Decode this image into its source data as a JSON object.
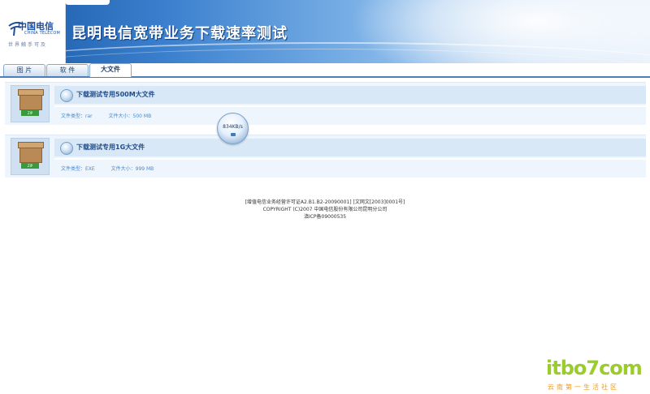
{
  "header": {
    "logo_cn": "中国电信",
    "logo_en": "CHINA TELECOM",
    "logo_slogan": "世界触手可及",
    "title": "昆明电信宽带业务下载速率测试"
  },
  "tabs": [
    {
      "label": "图 片",
      "active": false
    },
    {
      "label": "软 件",
      "active": false
    },
    {
      "label": "大文件",
      "active": true
    }
  ],
  "files": [
    {
      "name": "下载测试专用500M大文件",
      "type_label": "文件类型：rar",
      "size_label": "文件大小：500 MB",
      "icon": "zip-box-icon",
      "icon_tag": "ZIP"
    },
    {
      "name": "下载测试专用1G大文件",
      "type_label": "文件类型：EXE",
      "size_label": "文件大小：999 MB",
      "icon": "zip-box-icon",
      "icon_tag": "ZIP"
    }
  ],
  "speed_indicator": "834KB/s",
  "footer": {
    "line1": "[增值电信业务经营许可证A2.B1.B2-20090001] [文网文[2003]0001号]",
    "line2": "COPYRIGHT (C)2007 中国电信股份有限公司昆明分公司",
    "line3": "滇ICP备09000535"
  },
  "watermark": {
    "main": "itbo7com",
    "sub": "云南第一生活社区"
  },
  "colors": {
    "header_start": "#1a5aa8",
    "accent_blue": "#4c7fb8",
    "card_bg": "#eef5fc",
    "watermark_green": "#9acc2a",
    "watermark_orange": "#f39a1a"
  }
}
